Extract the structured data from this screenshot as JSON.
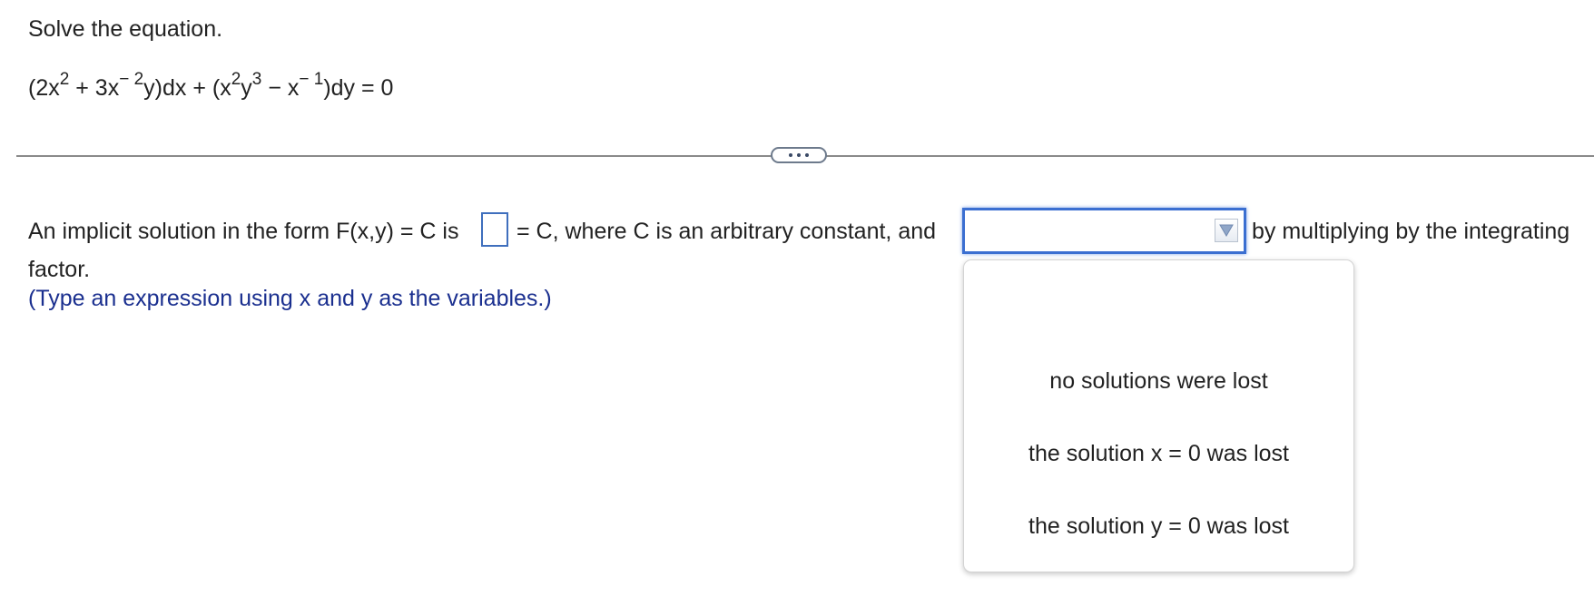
{
  "problem": {
    "instruction": "Solve the equation.",
    "equation": {
      "p1": "(2x",
      "s1": "2",
      "p2": " + 3x",
      "s2": "− 2",
      "p3": "y)dx + (x",
      "s3": "2",
      "p4": "y",
      "s4": "3",
      "p5": " − x",
      "s5": "− 1",
      "p6": ")dy = 0"
    }
  },
  "divider": {
    "more_label": "..."
  },
  "question": {
    "text_before_box": "An implicit solution in the form F(x,y) = C is",
    "text_after_box": "= C, where C is an arbitrary constant, and",
    "text_after_select": "by multiplying by the integrating",
    "text_line2": "factor.",
    "hint": "(Type an expression using x and y as the variables.)",
    "answer_value": "",
    "select_value": ""
  },
  "dropdown": {
    "options": [
      "no solutions were lost",
      "the solution x = 0 was lost",
      "the solution y = 0 was lost"
    ]
  },
  "colors": {
    "hint_text": "#1a2f8f",
    "input_border": "#3f6fbd",
    "select_focus_border": "#3b6fd1"
  }
}
